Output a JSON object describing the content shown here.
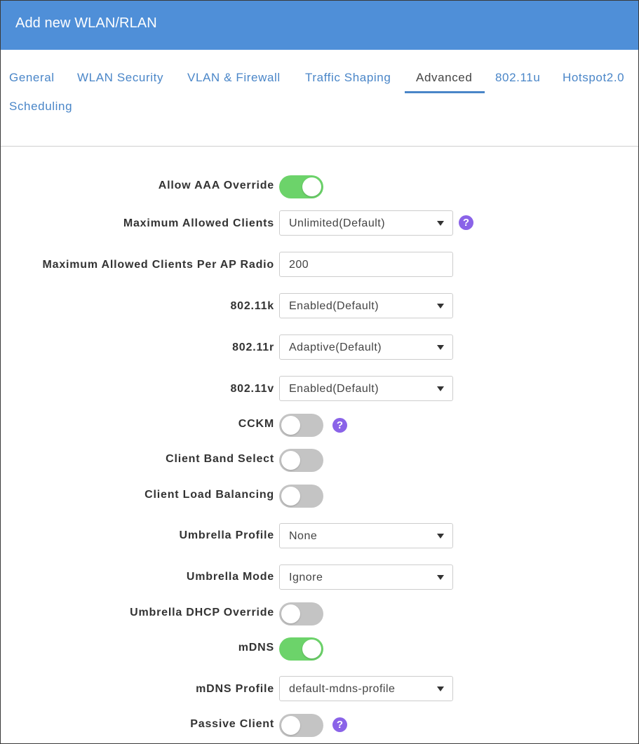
{
  "window": {
    "title": "Add new WLAN/RLAN"
  },
  "tabs": [
    {
      "label": "General"
    },
    {
      "label": "WLAN Security"
    },
    {
      "label": "VLAN & Firewall"
    },
    {
      "label": "Traffic Shaping"
    },
    {
      "label": "Advanced",
      "active": true
    },
    {
      "label": "802.11u"
    },
    {
      "label": "Hotspot2.0"
    },
    {
      "label": "Scheduling"
    }
  ],
  "form": {
    "allow_aaa_override": {
      "label": "Allow AAA Override",
      "on": true
    },
    "max_clients": {
      "label": "Maximum Allowed Clients",
      "value": "Unlimited(Default)"
    },
    "max_clients_per_ap_radio": {
      "label": "Maximum Allowed Clients Per AP Radio",
      "value": "200"
    },
    "dot11k": {
      "label": "802.11k",
      "value": "Enabled(Default)"
    },
    "dot11r": {
      "label": "802.11r",
      "value": "Adaptive(Default)"
    },
    "dot11v": {
      "label": "802.11v",
      "value": "Enabled(Default)"
    },
    "cckm": {
      "label": "CCKM",
      "on": false
    },
    "client_band_select": {
      "label": "Client Band Select",
      "on": false
    },
    "client_load_balancing": {
      "label": "Client Load Balancing",
      "on": false
    },
    "umbrella_profile": {
      "label": "Umbrella Profile",
      "value": "None"
    },
    "umbrella_mode": {
      "label": "Umbrella Mode",
      "value": "Ignore"
    },
    "umbrella_dhcp_override": {
      "label": "Umbrella DHCP Override",
      "on": false
    },
    "mdns": {
      "label": "mDNS",
      "on": true
    },
    "mdns_profile": {
      "label": "mDNS Profile",
      "value": "default-mdns-profile"
    },
    "passive_client": {
      "label": "Passive Client",
      "on": false
    }
  },
  "help_glyph": "?",
  "colors": {
    "header": "#4f8fd8",
    "tab_link": "#4a86c8",
    "toggle_on": "#6cd36a",
    "toggle_off": "#c4c4c4",
    "help": "#8a63e8"
  }
}
